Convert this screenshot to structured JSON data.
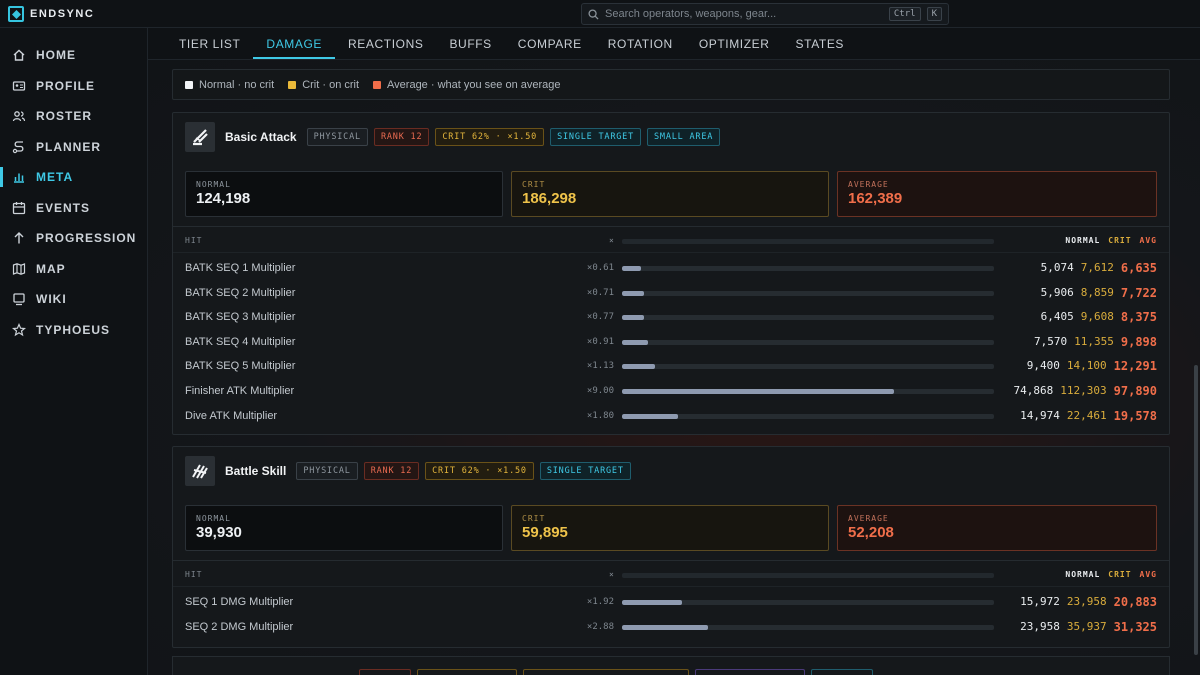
{
  "brand": {
    "name": "ENDSYNC",
    "accent": "#3fc9e6"
  },
  "search": {
    "placeholder": "Search operators, weapons, gear...",
    "kbd1": "Ctrl",
    "kbd2": "K"
  },
  "sidebar": {
    "items": [
      {
        "label": "HOME",
        "icon": "home-icon"
      },
      {
        "label": "PROFILE",
        "icon": "id-card-icon"
      },
      {
        "label": "ROSTER",
        "icon": "users-icon"
      },
      {
        "label": "PLANNER",
        "icon": "route-icon"
      },
      {
        "label": "META",
        "icon": "bar-chart-icon",
        "active": true
      },
      {
        "label": "EVENTS",
        "icon": "calendar-icon"
      },
      {
        "label": "PROGRESSION",
        "icon": "arrow-up-icon"
      },
      {
        "label": "MAP",
        "icon": "map-icon"
      },
      {
        "label": "WIKI",
        "icon": "book-icon"
      },
      {
        "label": "TYPHOEUS",
        "icon": "star-icon"
      }
    ]
  },
  "tabs": [
    "TIER LIST",
    "DAMAGE",
    "REACTIONS",
    "BUFFS",
    "COMPARE",
    "ROTATION",
    "OPTIMIZER",
    "STATES"
  ],
  "active_tab": "DAMAGE",
  "legend": [
    {
      "label": "Normal · no crit",
      "color": "#f2f4f6"
    },
    {
      "label": "Crit · on crit",
      "color": "#e9b93a"
    },
    {
      "label": "Average · what you see on average",
      "color": "#f06e4a"
    }
  ],
  "table_header": {
    "hit": "HIT",
    "mult": "×",
    "normal": "NORMAL",
    "crit": "CRIT",
    "avg": "AVG"
  },
  "cards": [
    {
      "title": "Basic Attack",
      "icon": "basic-attack-icon",
      "tags": [
        {
          "text": "PHYSICAL",
          "style": "gray"
        },
        {
          "text": "RANK 12",
          "style": "red"
        },
        {
          "text": "CRIT 62% · ×1.50",
          "style": "gold"
        },
        {
          "text": "SINGLE TARGET",
          "style": "cyan"
        },
        {
          "text": "SMALL AREA",
          "style": "cyan"
        }
      ],
      "stats": {
        "normal_label": "NORMAL",
        "normal": "124,198",
        "crit_label": "CRIT",
        "crit": "186,298",
        "avg_label": "AVERAGE",
        "avg": "162,389"
      },
      "rows": [
        {
          "name": "BATK SEQ 1 Multiplier",
          "mult": "×0.61",
          "fill": 0.05,
          "normal": "5,074",
          "crit": "7,612",
          "avg": "6,635"
        },
        {
          "name": "BATK SEQ 2 Multiplier",
          "mult": "×0.71",
          "fill": 0.06,
          "normal": "5,906",
          "crit": "8,859",
          "avg": "7,722"
        },
        {
          "name": "BATK SEQ 3 Multiplier",
          "mult": "×0.77",
          "fill": 0.06,
          "normal": "6,405",
          "crit": "9,608",
          "avg": "8,375"
        },
        {
          "name": "BATK SEQ 4 Multiplier",
          "mult": "×0.91",
          "fill": 0.07,
          "normal": "7,570",
          "crit": "11,355",
          "avg": "9,898"
        },
        {
          "name": "BATK SEQ 5 Multiplier",
          "mult": "×1.13",
          "fill": 0.09,
          "normal": "9,400",
          "crit": "14,100",
          "avg": "12,291"
        },
        {
          "name": "Finisher ATK Multiplier",
          "mult": "×9.00",
          "fill": 0.73,
          "normal": "74,868",
          "crit": "112,303",
          "avg": "97,890"
        },
        {
          "name": "Dive ATK Multiplier",
          "mult": "×1.80",
          "fill": 0.15,
          "normal": "14,974",
          "crit": "22,461",
          "avg": "19,578"
        }
      ]
    },
    {
      "title": "Battle Skill",
      "icon": "battle-skill-icon",
      "tags": [
        {
          "text": "PHYSICAL",
          "style": "gray"
        },
        {
          "text": "RANK 12",
          "style": "red"
        },
        {
          "text": "CRIT 62% · ×1.50",
          "style": "gold"
        },
        {
          "text": "SINGLE TARGET",
          "style": "cyan"
        }
      ],
      "stats": {
        "normal_label": "NORMAL",
        "normal": "39,930",
        "crit_label": "CRIT",
        "crit": "59,895",
        "avg_label": "AVERAGE",
        "avg": "52,208"
      },
      "rows": [
        {
          "name": "SEQ 1 DMG Multiplier",
          "mult": "×1.92",
          "fill": 0.16,
          "normal": "15,972",
          "crit": "23,958",
          "avg": "20,883"
        },
        {
          "name": "SEQ 2 DMG Multiplier",
          "mult": "×2.88",
          "fill": 0.23,
          "normal": "23,958",
          "crit": "35,937",
          "avg": "31,325"
        }
      ]
    }
  ]
}
